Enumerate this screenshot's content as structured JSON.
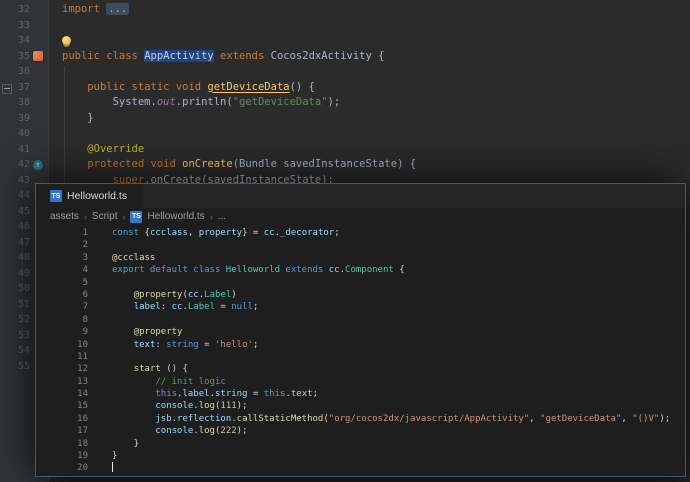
{
  "theme": {
    "darcula_bg": "#2b2b2b",
    "darcula_gutter_bg": "#313335",
    "vscode_bg": "#1e1e1e",
    "selection_blue": "#214283",
    "ts_badge_blue": "#3178c6",
    "overlay_border": "#4a5664"
  },
  "ide": {
    "lines": [
      {
        "no": "32",
        "tokens": [
          [
            "kw",
            "import "
          ],
          [
            "fold",
            "..."
          ]
        ]
      },
      {
        "no": "33",
        "tokens": []
      },
      {
        "no": "34",
        "tokens": [],
        "editor_icon": "lightbulb-icon"
      },
      {
        "no": "35",
        "tokens": [
          [
            "kw",
            "public class "
          ],
          [
            "sel",
            "AppActivity"
          ],
          [
            "kw",
            " extends "
          ],
          [
            "pl",
            "Cocos2dxActivity {"
          ]
        ],
        "gutter_icon": "class-icon"
      },
      {
        "no": "36",
        "tokens": []
      },
      {
        "no": "37",
        "tokens": [
          [
            "pl",
            "    "
          ],
          [
            "kw",
            "public static void "
          ],
          [
            "methu",
            "getDeviceData"
          ],
          [
            "pl",
            "() {"
          ]
        ],
        "fold_icon": true
      },
      {
        "no": "38",
        "tokens": [
          [
            "pl",
            "        System."
          ],
          [
            "fld",
            "out"
          ],
          [
            "pl",
            ".println("
          ],
          [
            "str",
            "\"getDeviceData\""
          ],
          [
            "pl",
            ");"
          ]
        ]
      },
      {
        "no": "39",
        "tokens": [
          [
            "pl",
            "    }"
          ]
        ]
      },
      {
        "no": "40",
        "tokens": []
      },
      {
        "no": "41",
        "tokens": [
          [
            "pl",
            "    "
          ],
          [
            "ann",
            "@Override"
          ]
        ]
      },
      {
        "no": "42",
        "tokens": [
          [
            "pl",
            "    "
          ],
          [
            "kw",
            "protected void "
          ],
          [
            "meth",
            "onCreate"
          ],
          [
            "pl",
            "(Bundle savedInstanceState) {"
          ]
        ],
        "gutter_icon": "override-icon"
      },
      {
        "no": "43",
        "tokens": [
          [
            "kw",
            "        super"
          ],
          [
            "pl",
            ".onCreate(savedInstanceState);"
          ]
        ]
      },
      {
        "no": "44",
        "tokens": []
      },
      {
        "no": "45",
        "tokens": []
      },
      {
        "no": "46",
        "tokens": []
      },
      {
        "no": "47",
        "tokens": []
      },
      {
        "no": "48",
        "tokens": []
      },
      {
        "no": "49",
        "tokens": []
      },
      {
        "no": "50",
        "tokens": []
      },
      {
        "no": "51",
        "tokens": []
      },
      {
        "no": "52",
        "tokens": []
      },
      {
        "no": "53",
        "tokens": []
      },
      {
        "no": "54",
        "tokens": []
      },
      {
        "no": "55",
        "tokens": []
      }
    ]
  },
  "overlay": {
    "tab": {
      "badge": "TS",
      "label": "Helloworld.ts"
    },
    "breadcrumb": {
      "separator": "›",
      "badge": "TS",
      "items": [
        "assets",
        "Script",
        "Helloworld.ts",
        "..."
      ]
    },
    "lines": [
      {
        "no": "1",
        "tokens": [
          [
            "vkw",
            "const "
          ],
          [
            "vpl",
            "{"
          ],
          [
            "vvar",
            "ccclass"
          ],
          [
            "vpl",
            ", "
          ],
          [
            "vvar",
            "property"
          ],
          [
            "vpl",
            "} = "
          ],
          [
            "vvar",
            "cc"
          ],
          [
            "vpl",
            "."
          ],
          [
            "vvar",
            "_decorator"
          ],
          [
            "vpl",
            ";"
          ]
        ]
      },
      {
        "no": "2",
        "tokens": []
      },
      {
        "no": "3",
        "tokens": [
          [
            "vfn",
            "@ccclass"
          ]
        ]
      },
      {
        "no": "4",
        "tokens": [
          [
            "vkw",
            "export default class "
          ],
          [
            "vcls",
            "Helloworld"
          ],
          [
            "vkw",
            " extends "
          ],
          [
            "vvar",
            "cc"
          ],
          [
            "vpl",
            "."
          ],
          [
            "vcls",
            "Component"
          ],
          [
            "vpl",
            " {"
          ]
        ]
      },
      {
        "no": "5",
        "tokens": []
      },
      {
        "no": "6",
        "tokens": [
          [
            "vpl",
            "    "
          ],
          [
            "vfn",
            "@property"
          ],
          [
            "vpl",
            "("
          ],
          [
            "vvar",
            "cc"
          ],
          [
            "vpl",
            "."
          ],
          [
            "vcls",
            "Label"
          ],
          [
            "vpl",
            ")"
          ]
        ]
      },
      {
        "no": "7",
        "tokens": [
          [
            "vpl",
            "    "
          ],
          [
            "vvar",
            "label"
          ],
          [
            "vpl",
            ": "
          ],
          [
            "vvar",
            "cc"
          ],
          [
            "vpl",
            "."
          ],
          [
            "vcls",
            "Label"
          ],
          [
            "vpl",
            " = "
          ],
          [
            "vkw",
            "null"
          ],
          [
            "vpl",
            ";"
          ]
        ]
      },
      {
        "no": "8",
        "tokens": []
      },
      {
        "no": "9",
        "tokens": [
          [
            "vpl",
            "    "
          ],
          [
            "vfn",
            "@property"
          ]
        ]
      },
      {
        "no": "10",
        "tokens": [
          [
            "vpl",
            "    "
          ],
          [
            "vvar",
            "text"
          ],
          [
            "vpl",
            ": "
          ],
          [
            "vkw",
            "string"
          ],
          [
            "vpl",
            " = "
          ],
          [
            "vstr",
            "'hello'"
          ],
          [
            "vpl",
            ";"
          ]
        ]
      },
      {
        "no": "11",
        "tokens": []
      },
      {
        "no": "12",
        "tokens": [
          [
            "vpl",
            "    "
          ],
          [
            "vfn",
            "start"
          ],
          [
            "vpl",
            " () {"
          ]
        ]
      },
      {
        "no": "13",
        "tokens": [
          [
            "vcom",
            "        // init logic"
          ]
        ]
      },
      {
        "no": "14",
        "tokens": [
          [
            "vpl",
            "        "
          ],
          [
            "vkw",
            "this"
          ],
          [
            "vpl",
            "."
          ],
          [
            "vvar",
            "label"
          ],
          [
            "vpl",
            "."
          ],
          [
            "vvar",
            "string"
          ],
          [
            "vpl",
            " = "
          ],
          [
            "vkw",
            "this"
          ],
          [
            "vpl",
            "."
          ],
          [
            "vvar",
            "text"
          ],
          [
            "vpl",
            ";"
          ]
        ]
      },
      {
        "no": "15",
        "tokens": [
          [
            "vpl",
            "        "
          ],
          [
            "vvar",
            "console"
          ],
          [
            "vpl",
            "."
          ],
          [
            "vfn",
            "log"
          ],
          [
            "vpl",
            "("
          ],
          [
            "vnum",
            "111"
          ],
          [
            "vpl",
            ");"
          ]
        ]
      },
      {
        "no": "16",
        "tokens": [
          [
            "vpl",
            "        "
          ],
          [
            "vvar",
            "jsb"
          ],
          [
            "vpl",
            "."
          ],
          [
            "vvar",
            "reflection"
          ],
          [
            "vpl",
            "."
          ],
          [
            "vfn",
            "callStaticMethod"
          ],
          [
            "vpl",
            "("
          ],
          [
            "vstr",
            "\"org/cocos2dx/javascript/AppActivity\""
          ],
          [
            "vpl",
            ", "
          ],
          [
            "vstr",
            "\"getDeviceData\""
          ],
          [
            "vpl",
            ", "
          ],
          [
            "vstr",
            "\"()V\""
          ],
          [
            "vpl",
            ");"
          ]
        ]
      },
      {
        "no": "17",
        "tokens": [
          [
            "vpl",
            "        "
          ],
          [
            "vvar",
            "console"
          ],
          [
            "vpl",
            "."
          ],
          [
            "vfn",
            "log"
          ],
          [
            "vpl",
            "("
          ],
          [
            "vnum",
            "222"
          ],
          [
            "vpl",
            ");"
          ]
        ]
      },
      {
        "no": "18",
        "tokens": [
          [
            "vpl",
            "    }"
          ]
        ]
      },
      {
        "no": "19",
        "tokens": [
          [
            "vpl",
            "}"
          ]
        ]
      },
      {
        "no": "20",
        "tokens": [],
        "cursor": true
      }
    ]
  }
}
